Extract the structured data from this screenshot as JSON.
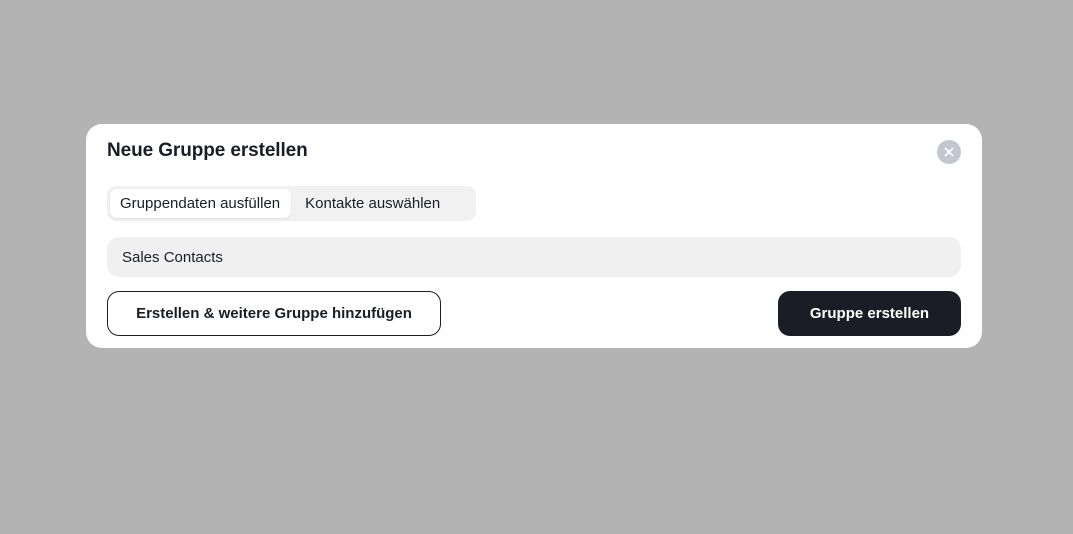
{
  "modal": {
    "title": "Neue Gruppe erstellen",
    "close_icon": "close-icon",
    "tabs": [
      {
        "label": "Gruppendaten ausfüllen",
        "active": true
      },
      {
        "label": "Kontakte auswählen",
        "active": false
      }
    ],
    "group_name": {
      "value": "Sales Contacts",
      "placeholder": ""
    },
    "secondary_button_label": "Erstellen & weitere Gruppe hinzufügen",
    "primary_button_label": "Gruppe erstellen"
  },
  "colors": {
    "backdrop": "#b3b3b3",
    "modal_bg": "#ffffff",
    "primary": "#1a1d26",
    "input_bg": "#f0f0f0",
    "close_bg": "#c3c6cf"
  }
}
